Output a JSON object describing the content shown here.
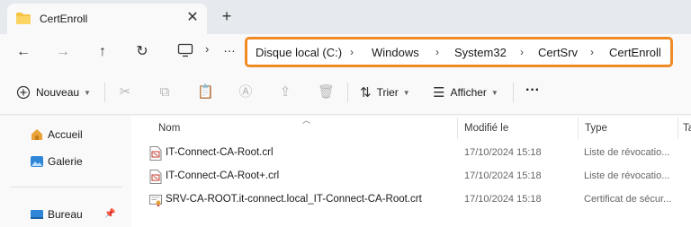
{
  "tab": {
    "title": "CertEnroll",
    "close": "✕",
    "new_tab": "+"
  },
  "nav": {
    "back": "←",
    "forward": "→",
    "up": "↑",
    "refresh": "↻",
    "more": "…",
    "chevron": "›",
    "breadcrumb": [
      "Disque local (C:)",
      "Windows",
      "System32",
      "CertSrv",
      "CertEnroll"
    ],
    "separator": "›",
    "highlight_color": "#f08a24"
  },
  "toolbar": {
    "new_label": "Nouveau",
    "sort_label": "Trier",
    "view_label": "Afficher",
    "more": "···"
  },
  "sidebar": {
    "items": [
      {
        "label": "Accueil",
        "icon": "home-icon"
      },
      {
        "label": "Galerie",
        "icon": "gallery-icon"
      },
      {
        "label": "Bureau",
        "icon": "desktop-icon"
      }
    ]
  },
  "columns": {
    "name": "Nom",
    "modified": "Modifié le",
    "type": "Type",
    "size": "Ta"
  },
  "files": [
    {
      "name": "IT-Connect-CA-Root.crl",
      "modified": "17/10/2024 15:18",
      "type": "Liste de révocatio...",
      "icon": "crl-file-icon"
    },
    {
      "name": "IT-Connect-CA-Root+.crl",
      "modified": "17/10/2024 15:18",
      "type": "Liste de révocatio...",
      "icon": "crl-file-icon"
    },
    {
      "name": "SRV-CA-ROOT.it-connect.local_IT-Connect-CA-Root.crt",
      "modified": "17/10/2024 15:18",
      "type": "Certificat de sécur...",
      "icon": "certificate-file-icon"
    }
  ]
}
